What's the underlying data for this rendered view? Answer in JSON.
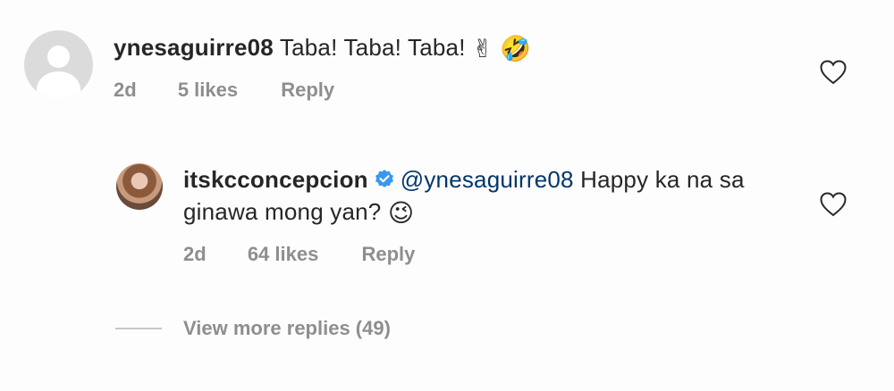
{
  "comments": [
    {
      "username": "ynesaguirre08",
      "text": "Taba! Taba! Taba!",
      "emojis": [
        "✌",
        "🤣"
      ],
      "time": "2d",
      "likes": "5 likes",
      "reply_label": "Reply",
      "avatar": "default-avatar-icon"
    },
    {
      "username": "itskcconcepcion",
      "verified": true,
      "mention": "@ynesaguirre08",
      "text": "Happy ka na sa ginawa mong yan?",
      "emojis": [
        "😉"
      ],
      "time": "2d",
      "likes": "64 likes",
      "reply_label": "Reply",
      "avatar": "profile-photo"
    }
  ],
  "view_more_replies": "View more replies (49)",
  "colors": {
    "text": "#262626",
    "meta": "#8e8e8e",
    "mention": "#00376b",
    "verified": "#3897f0"
  }
}
